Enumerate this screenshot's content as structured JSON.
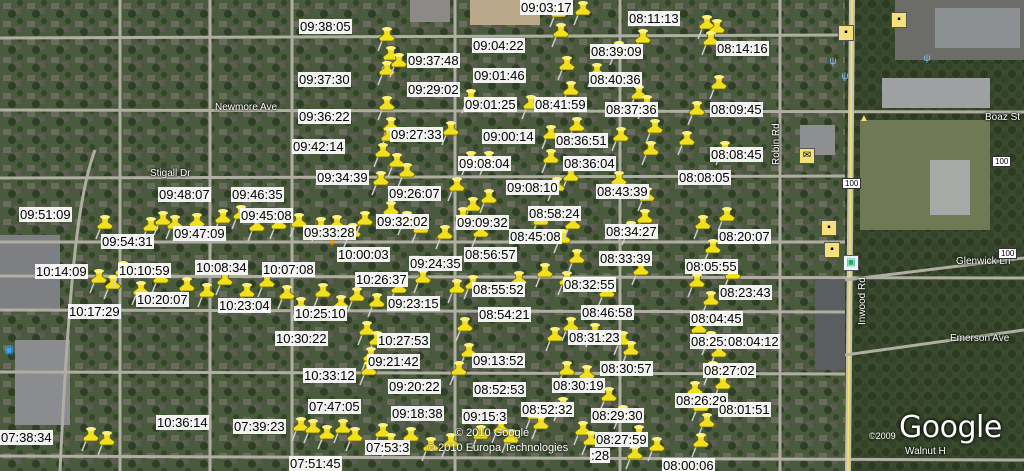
{
  "map": {
    "view": "satellite",
    "roads": {
      "newmore": "Newmore Ave",
      "stigall": "Stigall Dr",
      "boaz": "Boaz St",
      "glenwick": "Glenwick Ln",
      "emerson": "Emerson Ave",
      "robin": "Robin Rd",
      "inwood": "Inwood Rd",
      "walnut": "Walnut H"
    },
    "shields": [
      "100",
      "100",
      "100"
    ],
    "credits": {
      "copyright_google": "© 2010 Google",
      "copyright_europa": "© 2010 Europa Technologies",
      "year_mark": "©2009",
      "logo": "Google"
    }
  },
  "timestamps": [
    "09:03:17",
    "08:11:13",
    "09:38:05",
    "09:04:22",
    "08:39:09",
    "08:14:16",
    "09:37:48",
    "09:01:46",
    "08:40:36",
    "09:37:30",
    "09:29:02",
    "09:01:25",
    "08:41:59",
    "08:37:36",
    "08:09:45",
    "09:36:22",
    "09:27:33",
    "09:00:14",
    "08:36:51",
    "09:42:14",
    "09:08:04",
    "08:36:04",
    "08:08:45",
    "09:34:39",
    "09:26:07",
    "09:08:10",
    "08:43:39",
    "08:08:05",
    "09:48:07",
    "09:46:35",
    "09:51:09",
    "09:45:08",
    "09:32:02",
    "09:09:32",
    "08:58:24",
    "09:47:09",
    "09:54:31",
    "09:33:28",
    "08:45:08",
    "08:34:27",
    "08:20:07",
    "10:00:03",
    "08:56:57",
    "10:14:09",
    "10:10:59",
    "10:08:34",
    "10:07:08",
    "09:24:35",
    "08:33:39",
    "08:05:55",
    "10:26:37",
    "10:20:07",
    "10:23:04",
    "09:23:15",
    "08:55:52",
    "08:32:55",
    "08:23:43",
    "10:17:29",
    "10:25:10",
    "08:54:21",
    "08:46:58",
    "08:04:45",
    "10:30:22",
    "10:27:53",
    "08:31:23",
    "08:25:02",
    "08:04:12",
    "09:21:42",
    "09:13:52",
    "08:30:57",
    "10:33:12",
    "08:27:02",
    "09:20:22",
    "08:52:53",
    "08:30:19",
    "08:26:29",
    "07:47:05",
    "08:52:32",
    "08:01:51",
    "09:18:38",
    "09:15:3",
    "08:29:30",
    "10:36:14",
    "07:39:23",
    "07:38:34",
    "07:53:3",
    "08:27:59",
    "07:51:45",
    "08:00:06",
    ":28"
  ]
}
